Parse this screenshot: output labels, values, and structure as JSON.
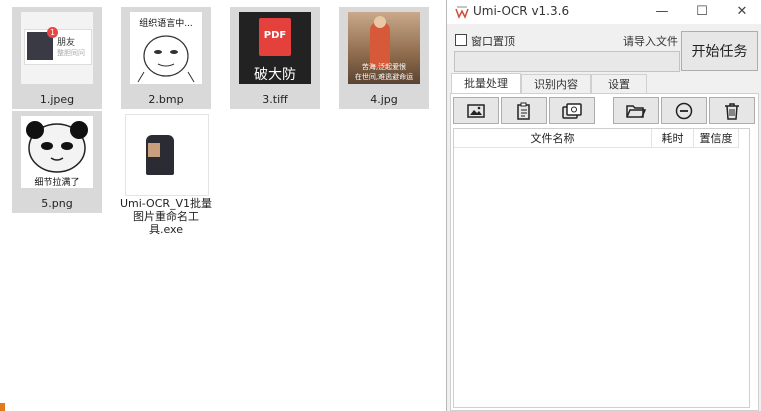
{
  "explorer": {
    "files": [
      {
        "name": "1.jpeg",
        "thumb_label": "朋友",
        "thumb_sub": "整胆同问",
        "badge": "1"
      },
      {
        "name": "2.bmp",
        "thumb_label": "组织语言中..."
      },
      {
        "name": "3.tiff",
        "thumb_label": "PDF",
        "thumb_sub": "破大防"
      },
      {
        "name": "4.jpg",
        "thumb_label": "苦海,泛起爱恨",
        "thumb_sub": "在世间,难逃避命运"
      },
      {
        "name": "5.png",
        "thumb_label": "细节拉满了"
      },
      {
        "name": "Umi-OCR_V1批量图片重命名工具.exe"
      }
    ]
  },
  "app": {
    "title": "Umi-OCR v1.3.6",
    "window_buttons": {
      "minimize": "—",
      "maximize": "☐",
      "close": "✕"
    },
    "topmost_label": "窗口置顶",
    "import_label": "请导入文件",
    "path_value": "",
    "start_button": "开始任务",
    "tabs": [
      "批量处理",
      "识别内容",
      "设置"
    ],
    "table": {
      "columns": [
        "文件名称",
        "耗时",
        "置信度"
      ]
    }
  },
  "colors": {
    "pdf_red": "#e5413c",
    "selected_tile": "#d9d9d9",
    "panel_bg": "#f0f0f0"
  }
}
